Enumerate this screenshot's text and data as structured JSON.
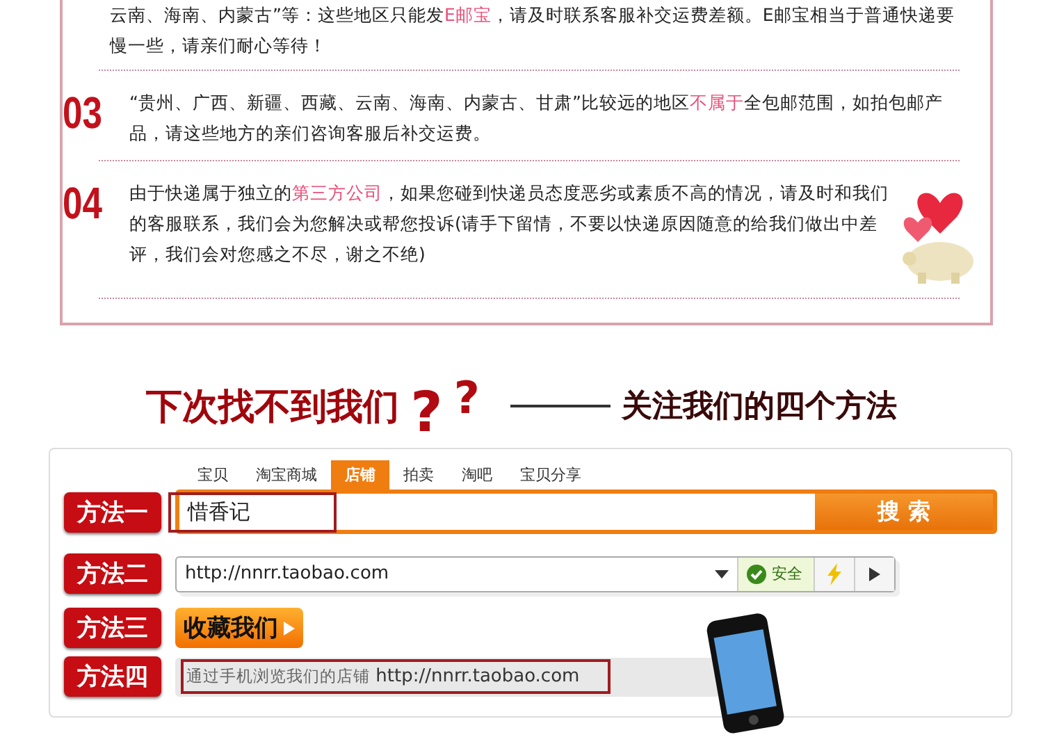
{
  "notice": {
    "items": [
      {
        "segments": [
          {
            "text": "云南、海南、内蒙古”等：这些地区只能发",
            "highlight": false
          },
          {
            "text": "E邮宝",
            "highlight": true
          },
          {
            "text": "，请及时联系客服补交运费差额。E邮宝相当于普通快递要慢一些，请亲们耐心等待！",
            "highlight": false
          }
        ]
      },
      {
        "number": "03",
        "segments": [
          {
            "text": "“贵州、广西、新疆、西藏、云南、海南、内蒙古、甘肃”比较远的地区",
            "highlight": false
          },
          {
            "text": "不属于",
            "highlight": true
          },
          {
            "text": "全包邮范围，如拍包邮产品，请这些地方的亲们咨询客服后补交运费。",
            "highlight": false
          }
        ]
      },
      {
        "number": "04",
        "segments": [
          {
            "text": "由于快递属于独立的",
            "highlight": false
          },
          {
            "text": "第三方公司",
            "highlight": true
          },
          {
            "text": "，如果您碰到快递员态度恶劣或素质不高的情况，请及时和我们的客服联系，我们会为您解决或帮您投诉(请手下留情，不要以快递原因随意的给我们做出中差评，我们会对您感之不尽，谢之不绝)",
            "highlight": false
          }
        ]
      }
    ]
  },
  "heading": {
    "main": "下次找不到我们",
    "marks": [
      "?",
      "?"
    ],
    "sub": "关注我们的四个方法"
  },
  "methods": [
    {
      "label": "方法一",
      "kind": "search",
      "tabs": [
        {
          "label": "宝贝",
          "selected": false
        },
        {
          "label": "淘宝商城",
          "selected": false
        },
        {
          "label": "店铺",
          "selected": true
        },
        {
          "label": "拍卖",
          "selected": false
        },
        {
          "label": "淘吧",
          "selected": false
        },
        {
          "label": "宝贝分享",
          "selected": false
        }
      ],
      "value": "惜香记",
      "button": "搜 索"
    },
    {
      "label": "方法二",
      "kind": "address",
      "url": "http://nnrr.taobao.com",
      "badge": "安全"
    },
    {
      "label": "方法三",
      "kind": "favorite",
      "button": "收藏我们"
    },
    {
      "label": "方法四",
      "kind": "mobile",
      "prefix": "通过手机浏览我们的店铺",
      "url": "http://nnrr.taobao.com"
    }
  ]
}
